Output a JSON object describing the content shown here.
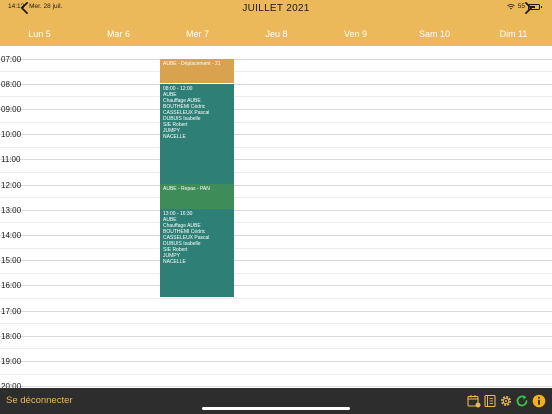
{
  "status_bar": {
    "time": "14:12",
    "date": "Mer. 28 juil.",
    "battery": "55"
  },
  "header": {
    "month": "JUILLET 2021"
  },
  "days": [
    {
      "label": "Lun 5"
    },
    {
      "label": "Mar 6"
    },
    {
      "label": "Mer 7"
    },
    {
      "label": "Jeu 8"
    },
    {
      "label": "Ven 9"
    },
    {
      "label": "Sam 10"
    },
    {
      "label": "Dim 11"
    }
  ],
  "hours": [
    "07:00",
    "08:00",
    "09:00",
    "10:00",
    "11:00",
    "12:00",
    "13:00",
    "14:00",
    "15:00",
    "16:00",
    "17:00",
    "18:00",
    "19:00",
    "20:00"
  ],
  "events": [
    {
      "lines": [
        "AUBE - Déplacement - 21"
      ]
    },
    {
      "lines": [
        "08:00 - 12:00",
        "AUBE",
        "Chauffage AUBE",
        "BOUTHEMI Cédric",
        "CASSELEUX Pascal",
        "DUBUIS Isabelle",
        "SIE Robert",
        "JUMPY",
        "NACELLE"
      ]
    },
    {
      "lines": [
        "AUBE - Repas - PAN"
      ]
    },
    {
      "lines": [
        "13:00 - 16:30",
        "AUBE",
        "Chauffage AUBE",
        "BOUTHEMI Cédric",
        "CASSELEUX Pascal",
        "DUBUIS Isabelle",
        "SIE Robert",
        "JUMPY",
        "NACELLE"
      ]
    }
  ],
  "footer": {
    "logout_label": "Se déconnecter"
  },
  "colors": {
    "header_bg": "#ECB95A",
    "event_teal": "#2E8077",
    "event_orange": "#D9A24F",
    "event_green": "#3E8D59",
    "footer_bg": "#2d2d2d",
    "logout_text": "#ECB95A"
  },
  "icons": [
    "calendar-export-icon",
    "book-icon",
    "gear-icon",
    "refresh-icon",
    "info-icon"
  ]
}
